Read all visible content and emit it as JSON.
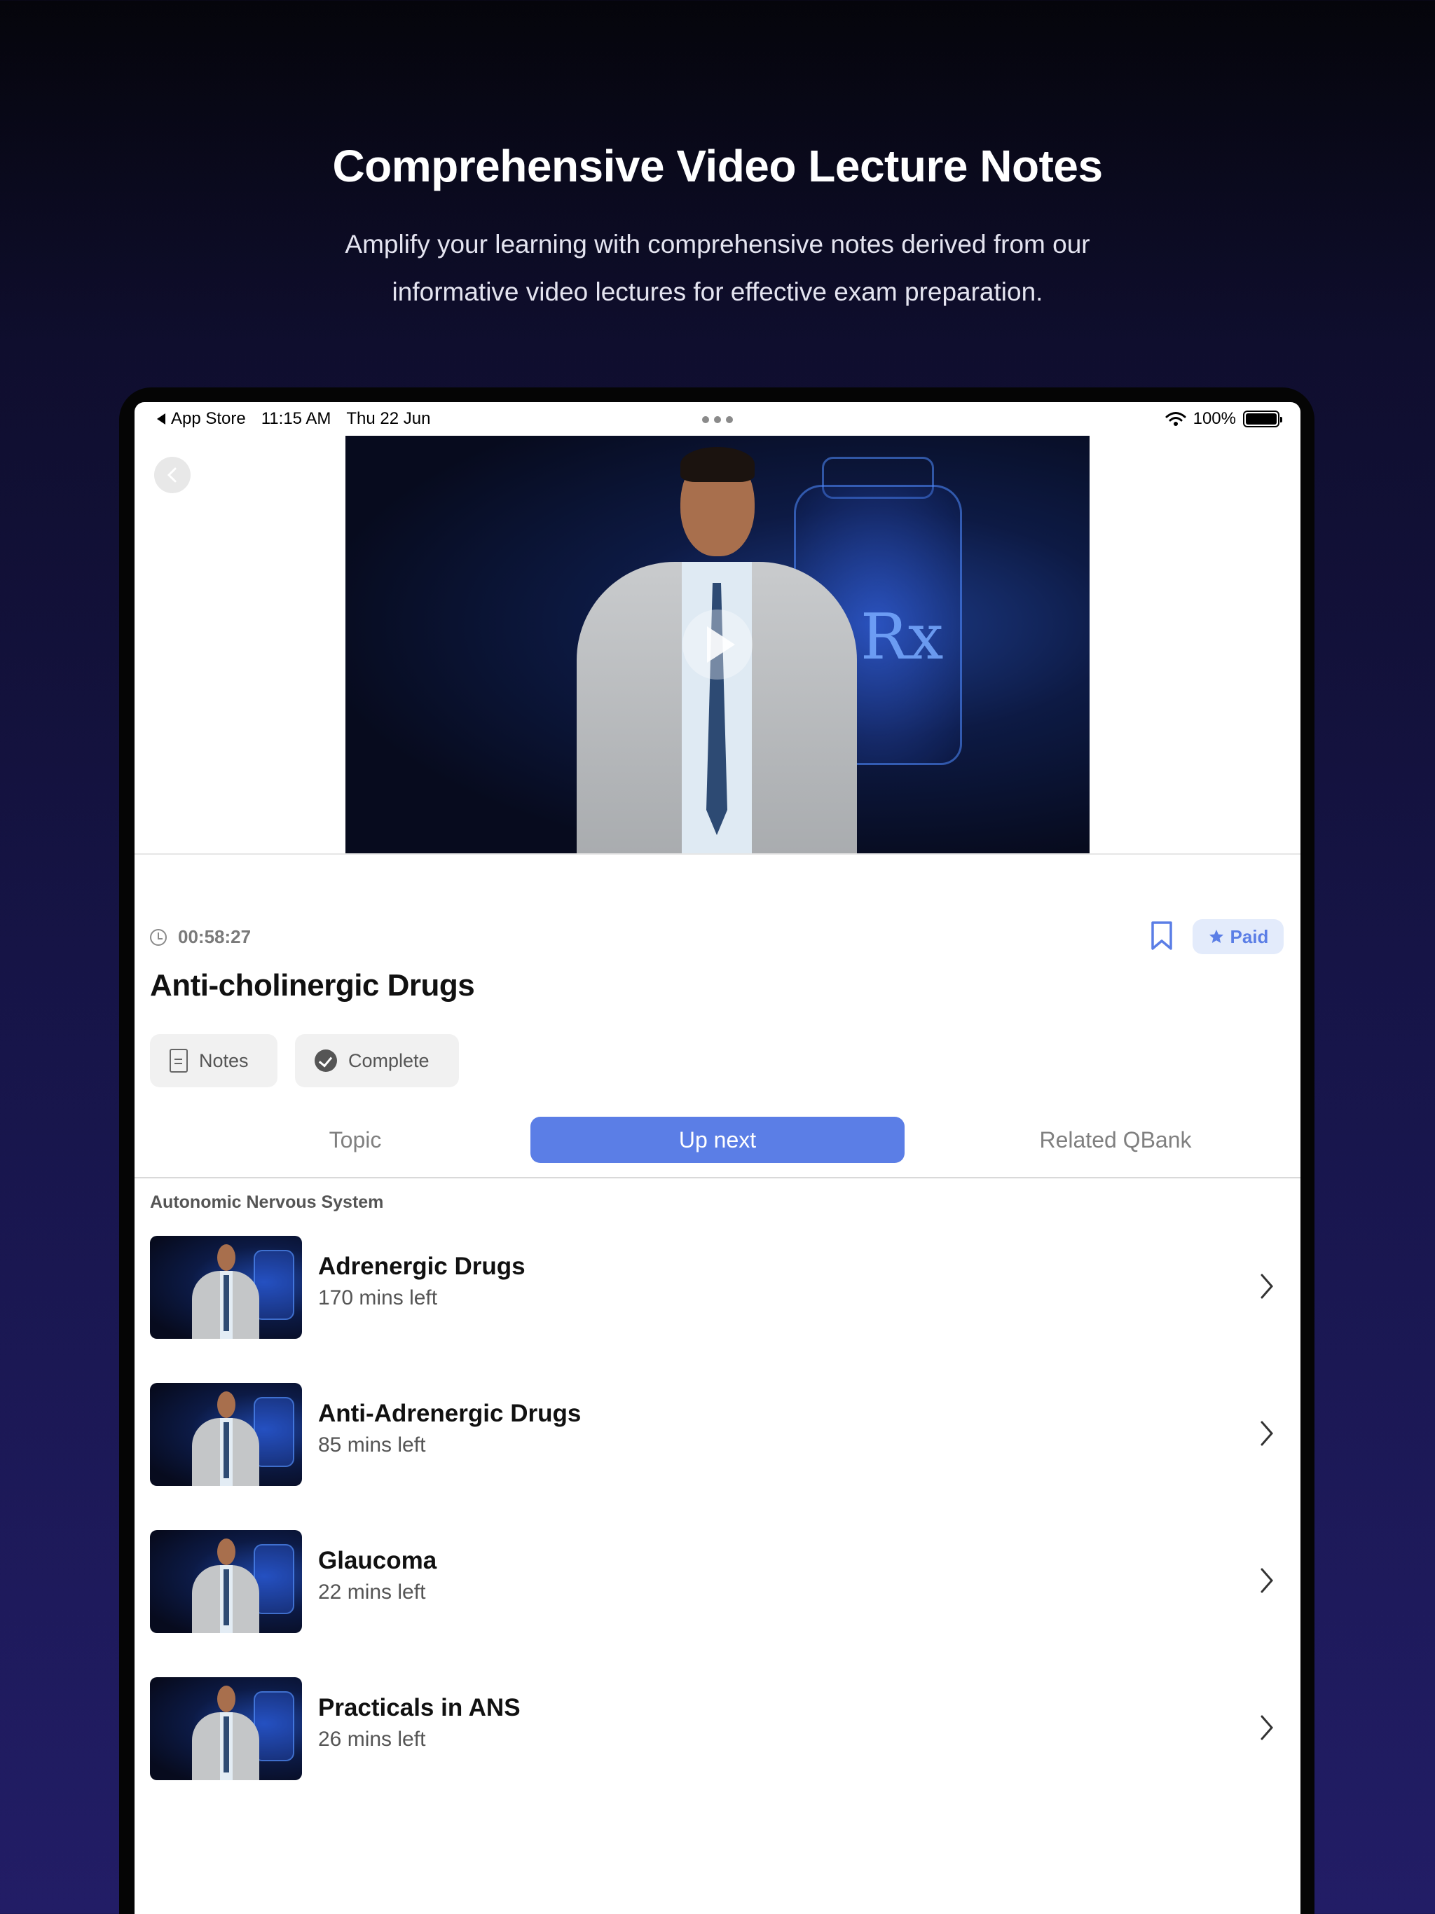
{
  "hero": {
    "title": "Comprehensive Video Lecture Notes",
    "subtitle": "Amplify your learning with comprehensive notes derived from our informative video lectures for effective exam preparation."
  },
  "status_bar": {
    "back_app": "App Store",
    "time": "11:15 AM",
    "date": "Thu 22 Jun",
    "battery": "100%"
  },
  "video": {
    "overlay_text": "Rx"
  },
  "lecture": {
    "duration": "00:58:27",
    "title": "Anti-cholinergic Drugs",
    "badge": "Paid",
    "chips": {
      "notes": "Notes",
      "complete": "Complete"
    }
  },
  "tabs": [
    {
      "label": "Topic",
      "active": false
    },
    {
      "label": "Up next",
      "active": true
    },
    {
      "label": "Related QBank",
      "active": false
    }
  ],
  "section": {
    "label": "Autonomic Nervous System"
  },
  "up_next": [
    {
      "title": "Adrenergic Drugs",
      "subtitle": "170 mins left"
    },
    {
      "title": "Anti-Adrenergic Drugs",
      "subtitle": "85 mins left"
    },
    {
      "title": "Glaucoma",
      "subtitle": "22 mins left"
    },
    {
      "title": "Practicals in ANS",
      "subtitle": "26 mins left"
    }
  ],
  "colors": {
    "accent": "#5b7ee6",
    "badge_bg": "#e3ebfb"
  }
}
